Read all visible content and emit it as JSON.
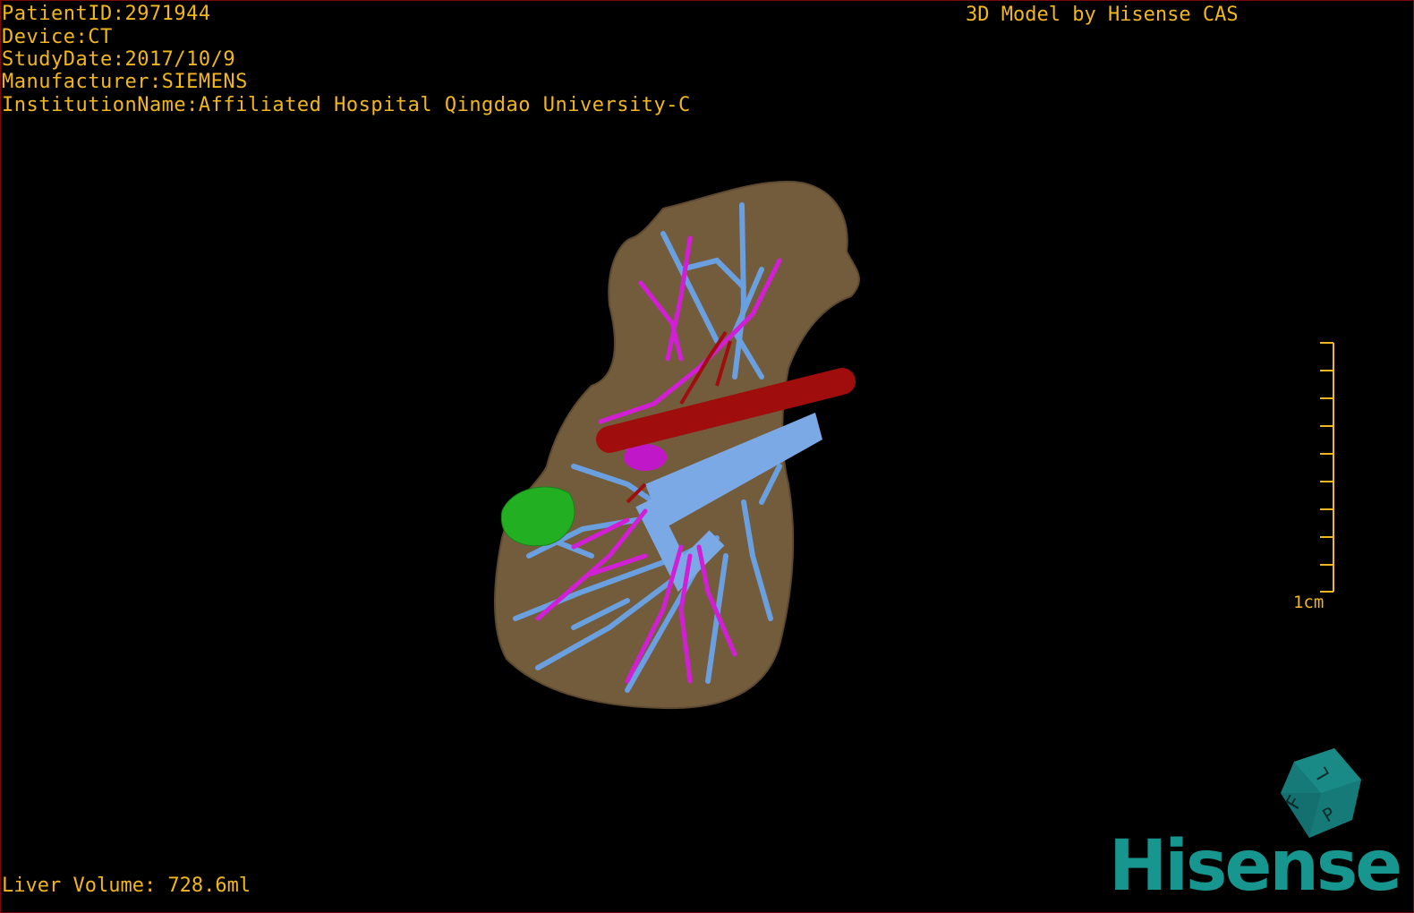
{
  "overlay": {
    "patient_id": "PatientID:2971944",
    "device": "Device:CT",
    "study_date": "StudyDate:2017/10/9",
    "manufacturer": "Manufacturer:SIEMENS",
    "institution": "InstitutionName:Affiliated Hospital Qingdao University-C",
    "model_credit": "3D Model by Hisense CAS",
    "liver_volume": "Liver Volume: 728.6ml",
    "scale_label": "1cm"
  },
  "orientation_cube": {
    "faces": [
      "F",
      "L",
      "P"
    ],
    "color": "#177f7d"
  },
  "logo": {
    "text": "Hisense",
    "color": "#17958f"
  },
  "colors": {
    "text": "#f2b71c",
    "liver": "#735c3c",
    "portal_vein": "#6a9fe0",
    "hepatic_artery": "#a00d0d",
    "hepatic_vein": "#d21fd6",
    "tumor": "#22b022"
  }
}
